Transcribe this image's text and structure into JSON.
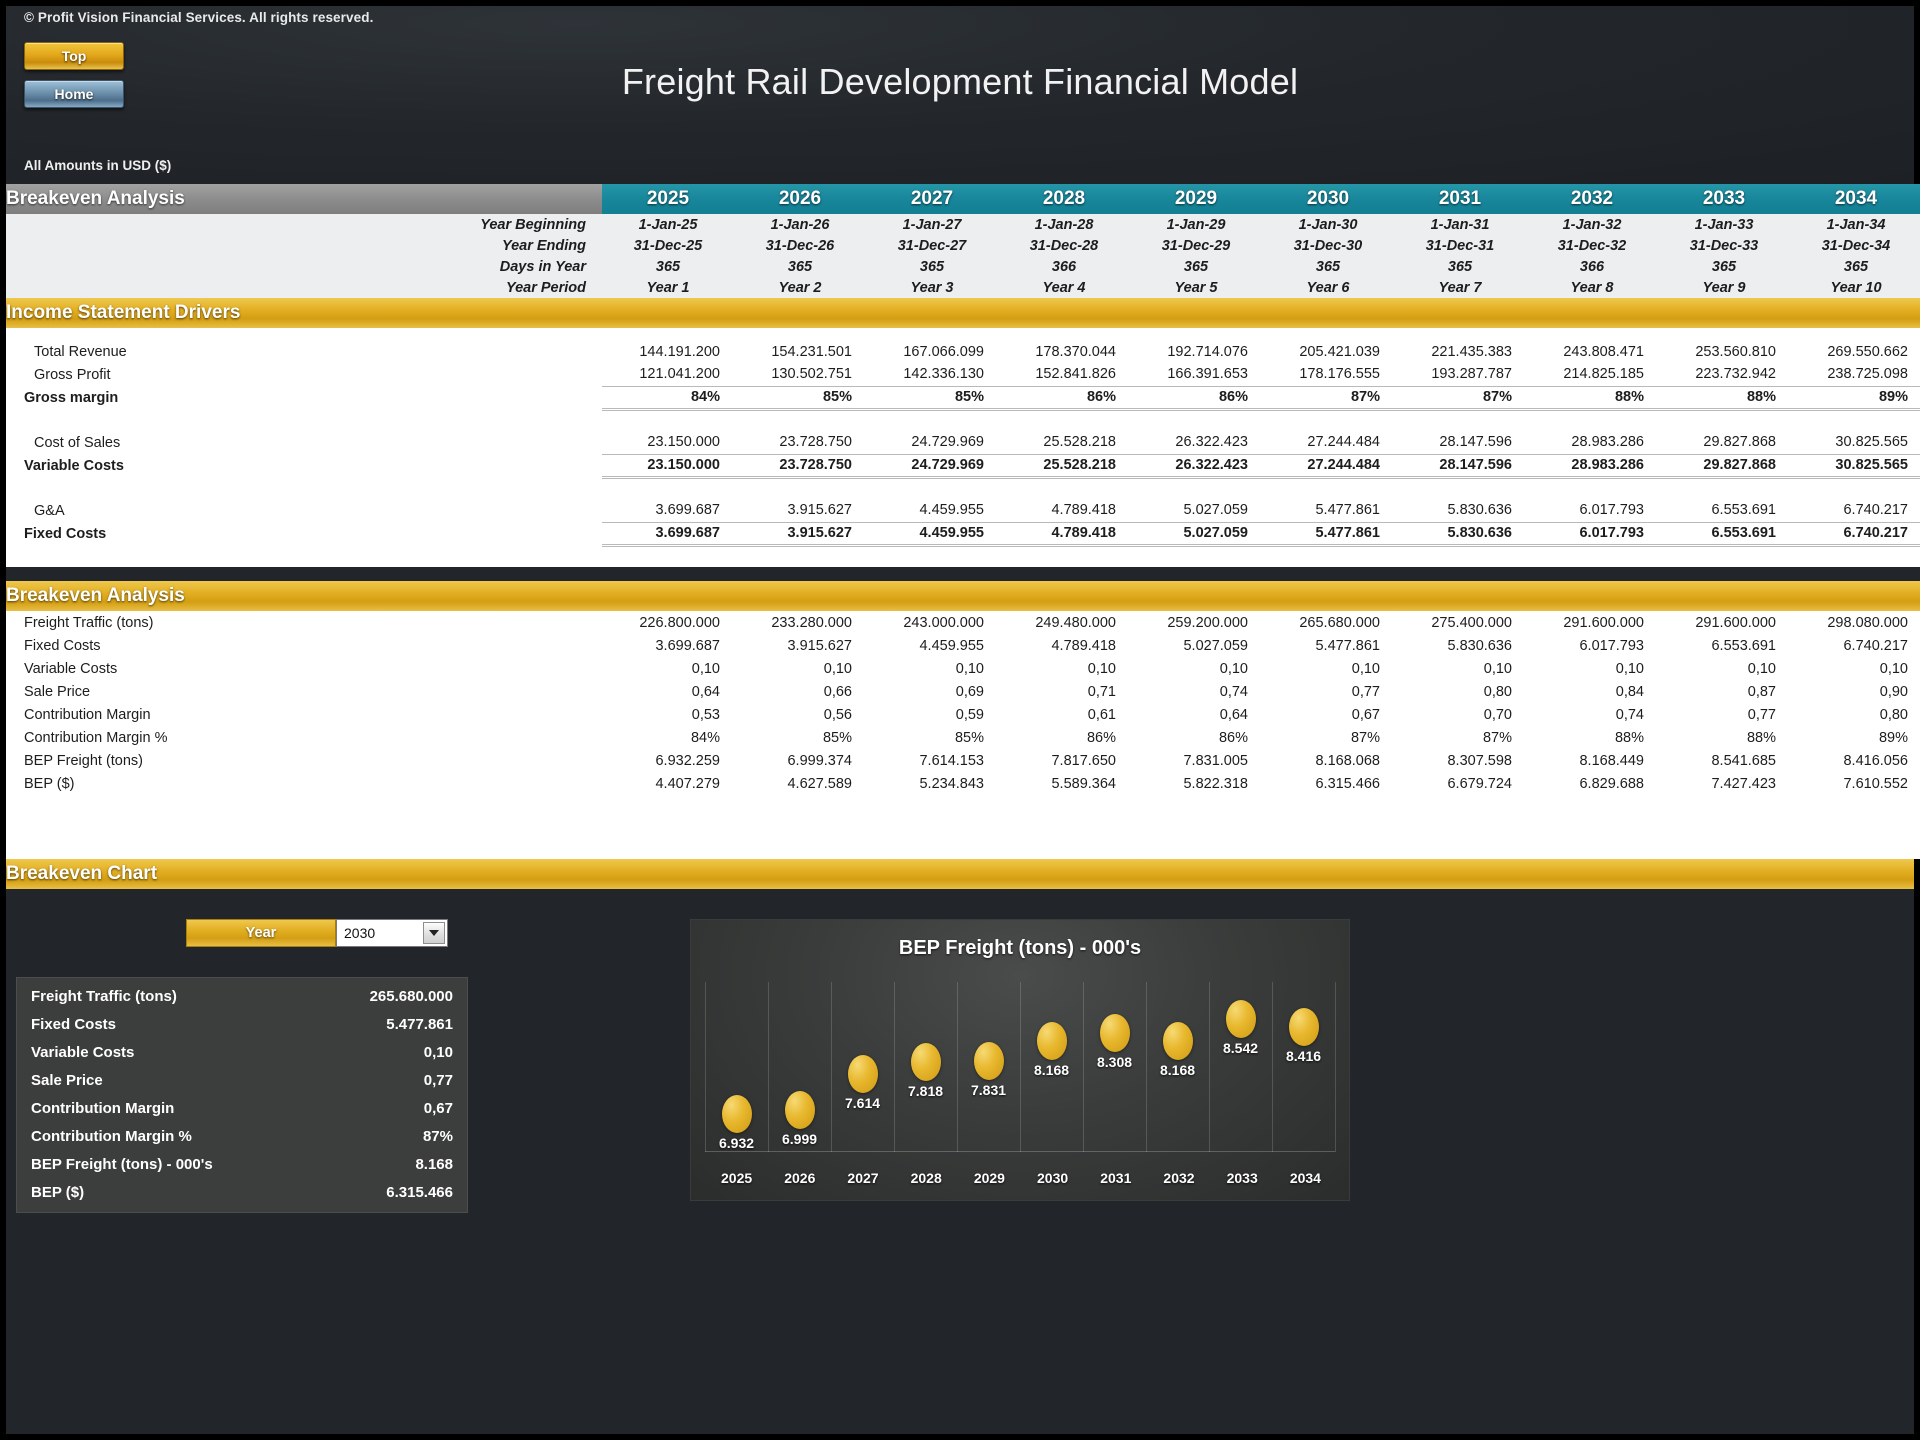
{
  "header": {
    "copyright": "© Profit Vision Financial Services. All rights reserved.",
    "title": "Freight Rail Development Financial Model",
    "amounts_note": "All Amounts in  USD ($)",
    "nav": {
      "top": "Top",
      "home": "Home"
    }
  },
  "colors": {
    "teal": "#17859a",
    "gold": "#e2ae22",
    "grey": "#8d8d8d",
    "dark_bg": "#22262a",
    "panel_bg": "#3c3e3d"
  },
  "table": {
    "section_title": "Breakeven Analysis",
    "years": [
      "2025",
      "2026",
      "2027",
      "2028",
      "2029",
      "2030",
      "2031",
      "2032",
      "2033",
      "2034"
    ],
    "date_rows": [
      {
        "label": "Year Beginning",
        "values": [
          "1-Jan-25",
          "1-Jan-26",
          "1-Jan-27",
          "1-Jan-28",
          "1-Jan-29",
          "1-Jan-30",
          "1-Jan-31",
          "1-Jan-32",
          "1-Jan-33",
          "1-Jan-34"
        ]
      },
      {
        "label": "Year Ending",
        "values": [
          "31-Dec-25",
          "31-Dec-26",
          "31-Dec-27",
          "31-Dec-28",
          "31-Dec-29",
          "31-Dec-30",
          "31-Dec-31",
          "31-Dec-32",
          "31-Dec-33",
          "31-Dec-34"
        ]
      },
      {
        "label": "Days in Year",
        "values": [
          "365",
          "365",
          "365",
          "366",
          "365",
          "365",
          "365",
          "366",
          "365",
          "365"
        ]
      },
      {
        "label": "Year Period",
        "values": [
          "Year 1",
          "Year 2",
          "Year 3",
          "Year 4",
          "Year 5",
          "Year 6",
          "Year 7",
          "Year 8",
          "Year 9",
          "Year 10"
        ]
      }
    ],
    "income_drivers": {
      "title": "Income Statement Drivers",
      "rows": [
        {
          "label": "Total Revenue",
          "bold": false,
          "values": [
            "144.191.200",
            "154.231.501",
            "167.066.099",
            "178.370.044",
            "192.714.076",
            "205.421.039",
            "221.435.383",
            "243.808.471",
            "253.560.810",
            "269.550.662"
          ]
        },
        {
          "label": "Gross Profit",
          "bold": false,
          "values": [
            "121.041.200",
            "130.502.751",
            "142.336.130",
            "152.841.826",
            "166.391.653",
            "178.176.555",
            "193.287.787",
            "214.825.185",
            "223.732.942",
            "238.725.098"
          ]
        },
        {
          "label": "Gross margin",
          "bold": true,
          "values": [
            "84%",
            "85%",
            "85%",
            "86%",
            "86%",
            "87%",
            "87%",
            "88%",
            "88%",
            "89%"
          ]
        },
        {
          "label": "Cost of Sales",
          "bold": false,
          "values": [
            "23.150.000",
            "23.728.750",
            "24.729.969",
            "25.528.218",
            "26.322.423",
            "27.244.484",
            "28.147.596",
            "28.983.286",
            "29.827.868",
            "30.825.565"
          ]
        },
        {
          "label": "Variable Costs",
          "bold": true,
          "values": [
            "23.150.000",
            "23.728.750",
            "24.729.969",
            "25.528.218",
            "26.322.423",
            "27.244.484",
            "28.147.596",
            "28.983.286",
            "29.827.868",
            "30.825.565"
          ]
        },
        {
          "label": "G&A",
          "bold": false,
          "values": [
            "3.699.687",
            "3.915.627",
            "4.459.955",
            "4.789.418",
            "5.027.059",
            "5.477.861",
            "5.830.636",
            "6.017.793",
            "6.553.691",
            "6.740.217"
          ]
        },
        {
          "label": "Fixed Costs",
          "bold": true,
          "values": [
            "3.699.687",
            "3.915.627",
            "4.459.955",
            "4.789.418",
            "5.027.059",
            "5.477.861",
            "5.830.636",
            "6.017.793",
            "6.553.691",
            "6.740.217"
          ]
        }
      ]
    },
    "breakeven": {
      "title": "Breakeven Analysis",
      "rows": [
        {
          "label": "Freight Traffic (tons)",
          "values": [
            "226.800.000",
            "233.280.000",
            "243.000.000",
            "249.480.000",
            "259.200.000",
            "265.680.000",
            "275.400.000",
            "291.600.000",
            "291.600.000",
            "298.080.000"
          ]
        },
        {
          "label": "Fixed Costs",
          "values": [
            "3.699.687",
            "3.915.627",
            "4.459.955",
            "4.789.418",
            "5.027.059",
            "5.477.861",
            "5.830.636",
            "6.017.793",
            "6.553.691",
            "6.740.217"
          ]
        },
        {
          "label": "Variable Costs",
          "values": [
            "0,10",
            "0,10",
            "0,10",
            "0,10",
            "0,10",
            "0,10",
            "0,10",
            "0,10",
            "0,10",
            "0,10"
          ]
        },
        {
          "label": "Sale Price",
          "values": [
            "0,64",
            "0,66",
            "0,69",
            "0,71",
            "0,74",
            "0,77",
            "0,80",
            "0,84",
            "0,87",
            "0,90"
          ]
        },
        {
          "label": "Contribution Margin",
          "values": [
            "0,53",
            "0,56",
            "0,59",
            "0,61",
            "0,64",
            "0,67",
            "0,70",
            "0,74",
            "0,77",
            "0,80"
          ]
        },
        {
          "label": "Contribution Margin %",
          "values": [
            "84%",
            "85%",
            "85%",
            "86%",
            "86%",
            "87%",
            "87%",
            "88%",
            "88%",
            "89%"
          ]
        },
        {
          "label": "BEP Freight (tons)",
          "values": [
            "6.932.259",
            "6.999.374",
            "7.614.153",
            "7.817.650",
            "7.831.005",
            "8.168.068",
            "8.307.598",
            "8.168.449",
            "8.541.685",
            "8.416.056"
          ]
        },
        {
          "label": "BEP ($)",
          "values": [
            "4.407.279",
            "4.627.589",
            "5.234.843",
            "5.589.364",
            "5.822.318",
            "6.315.466",
            "6.679.724",
            "6.829.688",
            "7.427.423",
            "7.610.552"
          ]
        }
      ]
    }
  },
  "breakeven_chart_section": {
    "title": "Breakeven Chart",
    "selector": {
      "label": "Year",
      "value": "2030"
    },
    "summary": [
      {
        "key": "Freight Traffic (tons)",
        "value": "265.680.000"
      },
      {
        "key": "Fixed Costs",
        "value": "5.477.861"
      },
      {
        "key": "Variable Costs",
        "value": "0,10"
      },
      {
        "key": "Sale Price",
        "value": "0,77"
      },
      {
        "key": "Contribution Margin",
        "value": "0,67"
      },
      {
        "key": "Contribution Margin %",
        "value": "87%"
      },
      {
        "key": "BEP Freight (tons) - 000's",
        "value": "8.168"
      },
      {
        "key": "BEP ($)",
        "value": "6.315.466"
      }
    ]
  },
  "chart_data": {
    "type": "scatter",
    "title": "BEP Freight (tons) - 000's",
    "xlabel": "",
    "ylabel": "",
    "categories": [
      "2025",
      "2026",
      "2027",
      "2028",
      "2029",
      "2030",
      "2031",
      "2032",
      "2033",
      "2034"
    ],
    "values": [
      6.932,
      6.999,
      7.614,
      7.818,
      7.831,
      8.168,
      8.308,
      8.168,
      8.542,
      8.416
    ],
    "labels": [
      "6.932",
      "6.999",
      "7.614",
      "7.818",
      "7.831",
      "8.168",
      "8.308",
      "8.168",
      "8.542",
      "8.416"
    ],
    "ylim": [
      6.6,
      8.75
    ],
    "grid": true,
    "legend": "none",
    "marker": "ellipse",
    "marker_color": "#e8b82f",
    "background": "#3a3c3b"
  }
}
